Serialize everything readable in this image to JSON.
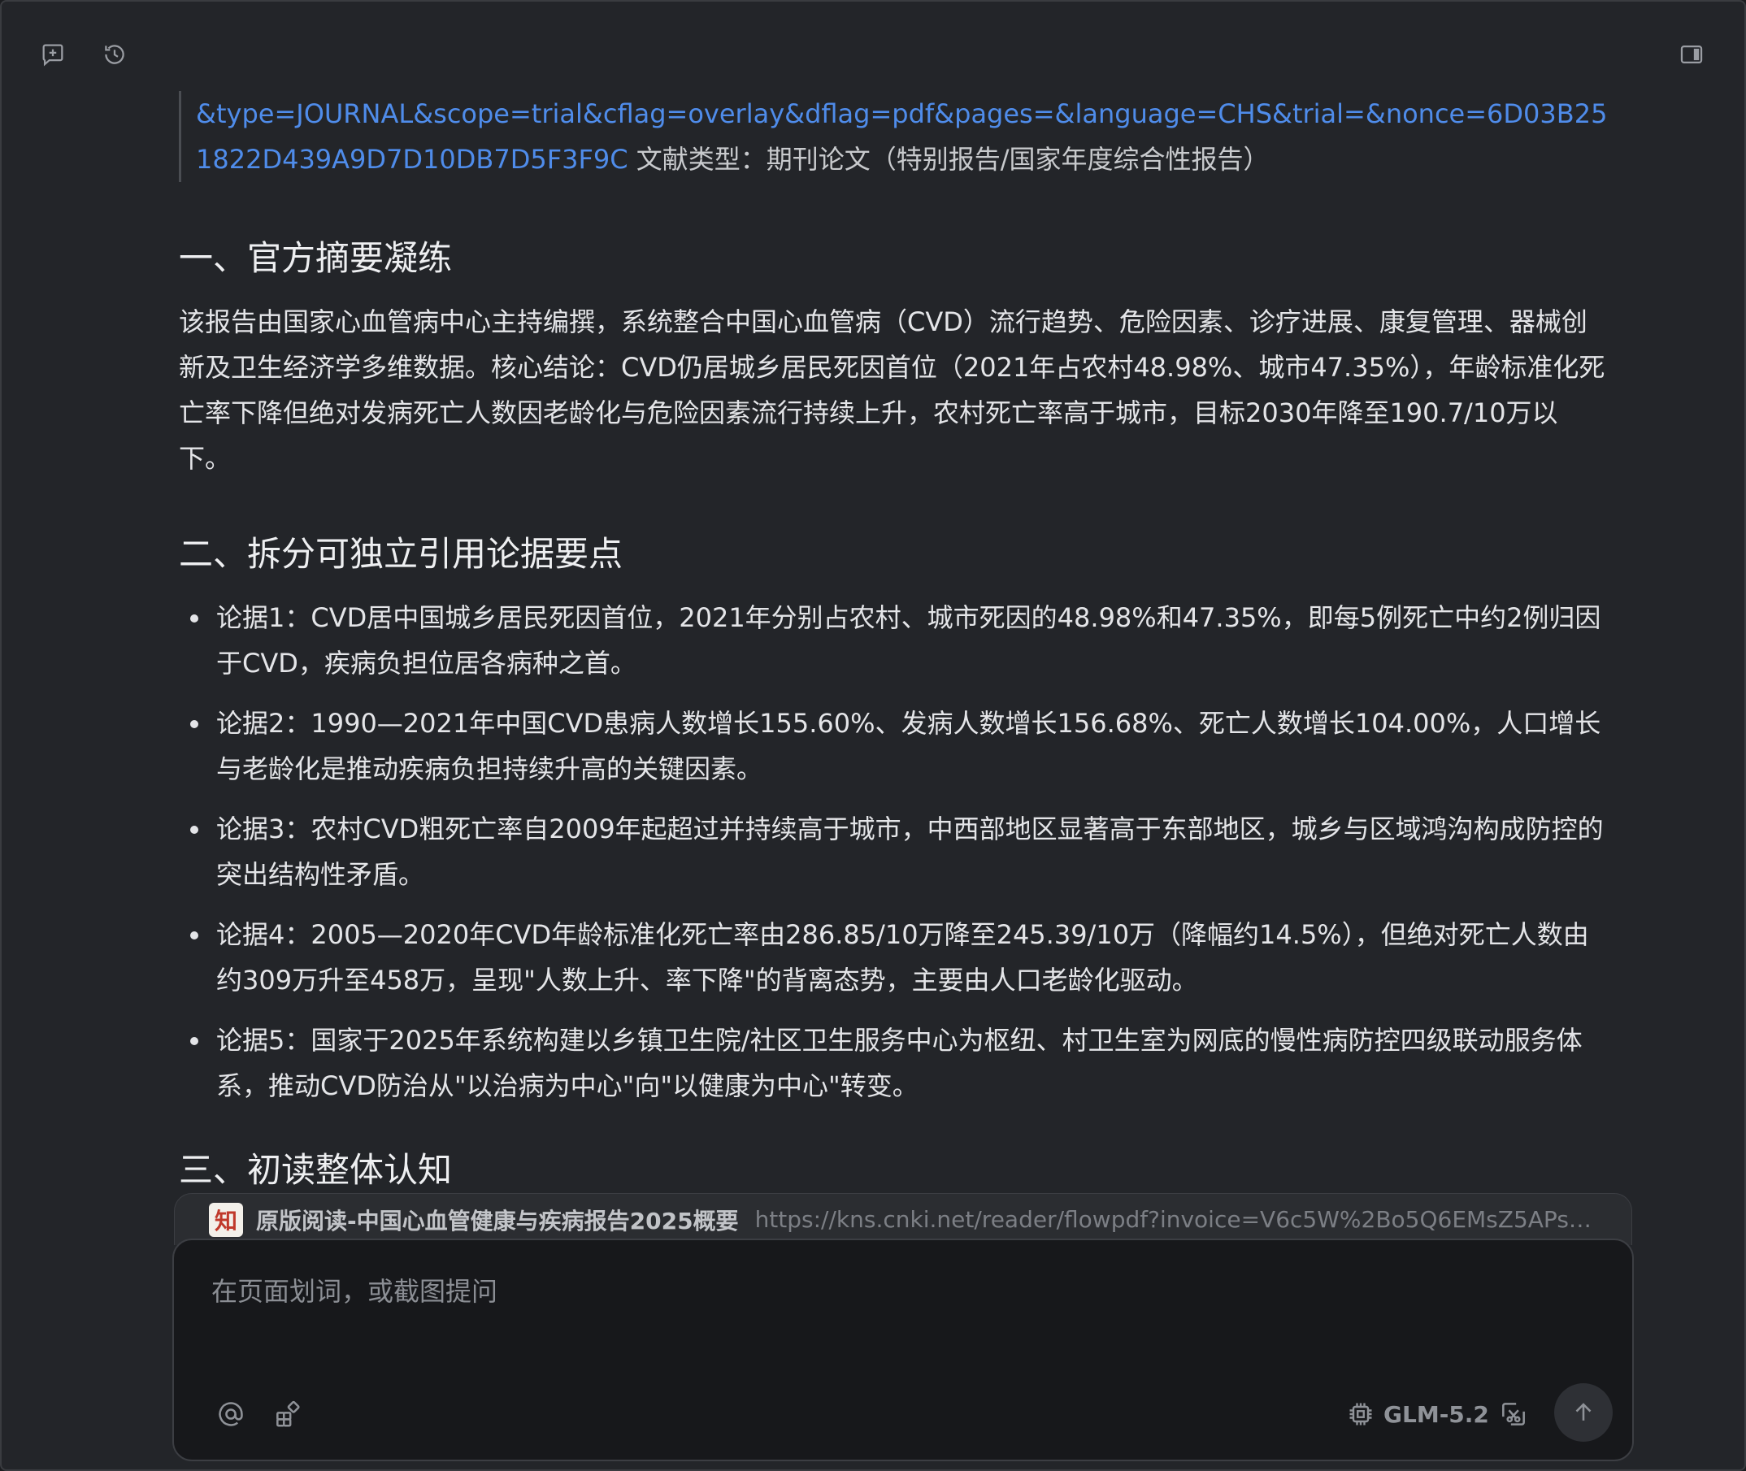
{
  "reference": {
    "link_text": "&type=JOURNAL&scope=trial&cflag=overlay&dflag=pdf&pages=&language=CHS&trial=&nonce=6D03B251822D439A9D7D10DB7D5F3F9C",
    "doc_type_text": " 文献类型：期刊论文（特别报告/国家年度综合性报告）"
  },
  "sections": [
    {
      "heading": "一、官方摘要凝练",
      "body": "该报告由国家心血管病中心主持编撰，系统整合中国心血管病（CVD）流行趋势、危险因素、诊疗进展、康复管理、器械创新及卫生经济学多维数据。核心结论：CVD仍居城乡居民死因首位（2021年占农村48.98%、城市47.35%），年龄标准化死亡率下降但绝对发病死亡人数因老龄化与危险因素流行持续上升，农村死亡率高于城市，目标2030年降至190.7/10万以下。"
    },
    {
      "heading": "二、拆分可独立引用论据要点",
      "points": [
        "论据1：CVD居中国城乡居民死因首位，2021年分别占农村、城市死因的48.98%和47.35%，即每5例死亡中约2例归因于CVD，疾病负担位居各病种之首。",
        "论据2：1990—2021年中国CVD患病人数增长155.60%、发病人数增长156.68%、死亡人数增长104.00%，人口增长与老龄化是推动疾病负担持续升高的关键因素。",
        "论据3：农村CVD粗死亡率自2009年起超过并持续高于城市，中西部地区显著高于东部地区，城乡与区域鸿沟构成防控的突出结构性矛盾。",
        "论据4：2005—2020年CVD年龄标准化死亡率由286.85/10万降至245.39/10万（降幅约14.5%），但绝对死亡人数由约309万升至458万，呈现\"人数上升、率下降\"的背离态势，主要由人口老龄化驱动。",
        "论据5：国家于2025年系统构建以乡镇卫生院/社区卫生服务中心为枢纽、村卫生室为网底的慢性病防控四级联动服务体系，推动CVD防治从\"以治病为中心\"向\"以健康为中心\"转变。"
      ]
    },
    {
      "heading": "三、初读整体认知"
    }
  ],
  "source": {
    "logo_text": "知",
    "title": "原版阅读-中国心血管健康与疾病报告2025概要",
    "url": "https://kns.cnki.net/reader/flowpdf?invoice=V6c5W%2Bo5Q6EMsZ5APsb%2B..."
  },
  "composer": {
    "placeholder": "在页面划词，或截图提问",
    "model": "GLM-5.2"
  },
  "colors": {
    "link": "#4f8cea",
    "background": "#232529",
    "composer_bg": "#17181b"
  },
  "icons": {
    "new_chat": "new-chat-icon",
    "history": "history-icon",
    "sidebar_toggle": "sidebar-toggle-icon",
    "mention": "at-icon",
    "apps": "apps-icon",
    "model": "chip-icon",
    "screenshot": "screenshot-icon",
    "send": "arrow-up-icon"
  }
}
